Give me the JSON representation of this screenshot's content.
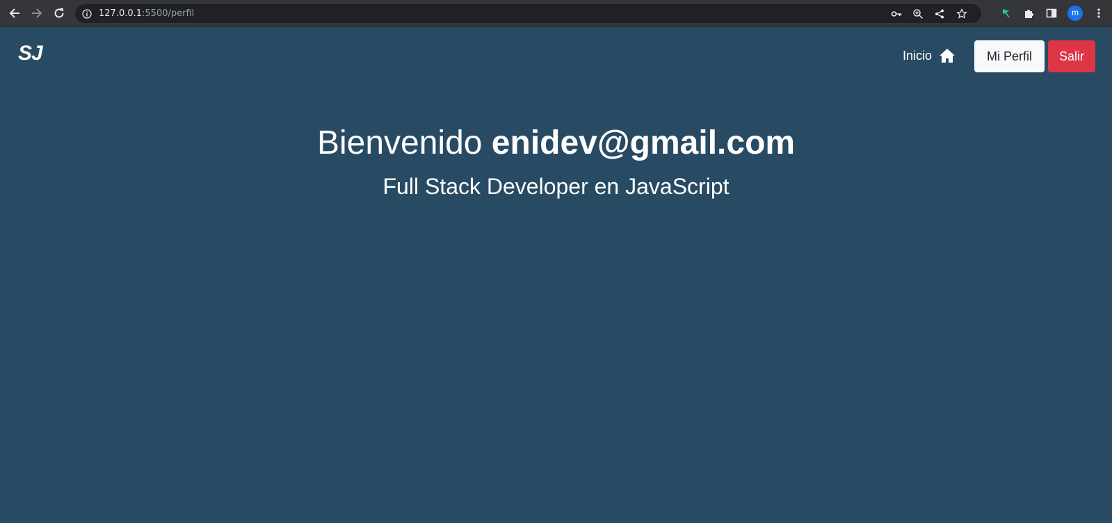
{
  "browser": {
    "url_host": "127.0.0.1",
    "url_rest": ":5500/perfil",
    "profile_initial": "m"
  },
  "navbar": {
    "logo": "SJ",
    "home_link": "Inicio",
    "profile_button": "Mi Perfil",
    "logout_button": "Salir"
  },
  "hero": {
    "greeting": "Bienvenido",
    "email": "enidev@gmail.com",
    "subtitle": "Full Stack Developer en JavaScript"
  },
  "colors": {
    "page_background": "#284b63",
    "logout_button": "#dc3545",
    "profile_button": "#f8f9fa"
  }
}
